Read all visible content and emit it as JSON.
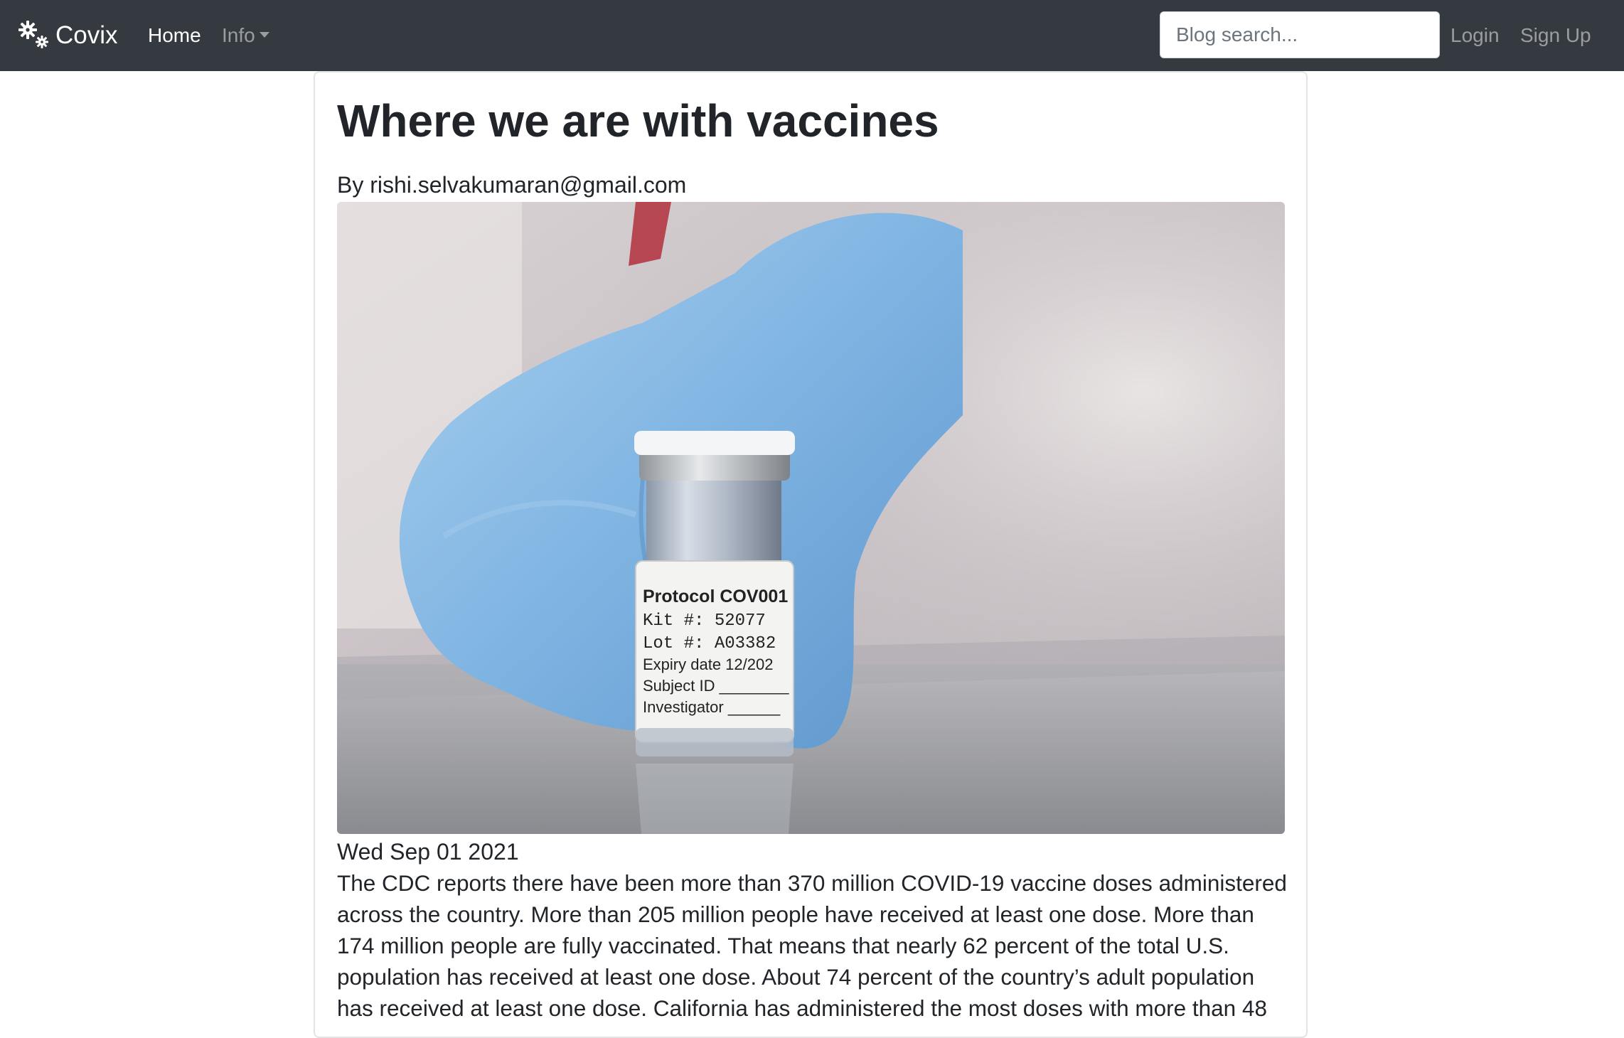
{
  "navbar": {
    "brand_icon": "gears-icon",
    "brand": "Covix",
    "home_label": "Home",
    "info_label": "Info",
    "search_placeholder": "Blog search...",
    "login_label": "Login",
    "signup_label": "Sign Up",
    "background": "#343a40"
  },
  "post": {
    "title": "Where we are with vaccines",
    "byline": "By rishi.selvakumaran@gmail.com",
    "image": {
      "label_lines": [
        "Protocol COV001",
        "Kit #:  52077",
        "Lot #:  A03382",
        "Expiry date  12/202",
        "Subject ID ________",
        "Investigator ______"
      ]
    },
    "date": "Wed Sep 01 2021",
    "body": "The CDC reports there have been more than 370 million COVID-19 vaccine doses administered across the country. More than 205 million people have received at least one dose. More than 174 million people are fully vaccinated. That means that nearly 62 percent of the total U.S. population has received at least one dose. About 74 percent of the country’s adult population has received at least one dose. California has administered the most doses with more than 48"
  }
}
